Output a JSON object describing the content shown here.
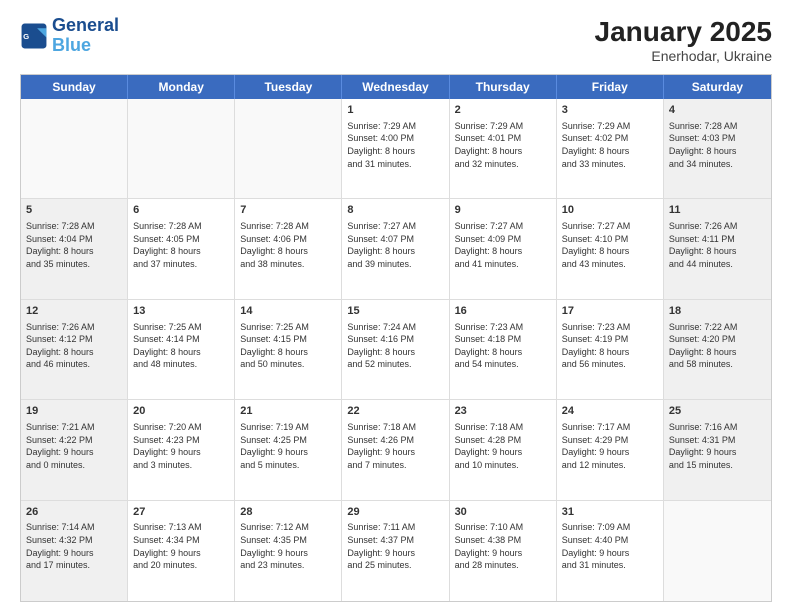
{
  "header": {
    "logo_line1": "General",
    "logo_line2": "Blue",
    "title": "January 2025",
    "subtitle": "Enerhodar, Ukraine"
  },
  "weekdays": [
    "Sunday",
    "Monday",
    "Tuesday",
    "Wednesday",
    "Thursday",
    "Friday",
    "Saturday"
  ],
  "weeks": [
    [
      {
        "day": "",
        "details": "",
        "shaded": false,
        "empty": true
      },
      {
        "day": "",
        "details": "",
        "shaded": false,
        "empty": true
      },
      {
        "day": "",
        "details": "",
        "shaded": false,
        "empty": true
      },
      {
        "day": "1",
        "details": "Sunrise: 7:29 AM\nSunset: 4:00 PM\nDaylight: 8 hours\nand 31 minutes.",
        "shaded": false,
        "empty": false
      },
      {
        "day": "2",
        "details": "Sunrise: 7:29 AM\nSunset: 4:01 PM\nDaylight: 8 hours\nand 32 minutes.",
        "shaded": false,
        "empty": false
      },
      {
        "day": "3",
        "details": "Sunrise: 7:29 AM\nSunset: 4:02 PM\nDaylight: 8 hours\nand 33 minutes.",
        "shaded": false,
        "empty": false
      },
      {
        "day": "4",
        "details": "Sunrise: 7:28 AM\nSunset: 4:03 PM\nDaylight: 8 hours\nand 34 minutes.",
        "shaded": true,
        "empty": false
      }
    ],
    [
      {
        "day": "5",
        "details": "Sunrise: 7:28 AM\nSunset: 4:04 PM\nDaylight: 8 hours\nand 35 minutes.",
        "shaded": true,
        "empty": false
      },
      {
        "day": "6",
        "details": "Sunrise: 7:28 AM\nSunset: 4:05 PM\nDaylight: 8 hours\nand 37 minutes.",
        "shaded": false,
        "empty": false
      },
      {
        "day": "7",
        "details": "Sunrise: 7:28 AM\nSunset: 4:06 PM\nDaylight: 8 hours\nand 38 minutes.",
        "shaded": false,
        "empty": false
      },
      {
        "day": "8",
        "details": "Sunrise: 7:27 AM\nSunset: 4:07 PM\nDaylight: 8 hours\nand 39 minutes.",
        "shaded": false,
        "empty": false
      },
      {
        "day": "9",
        "details": "Sunrise: 7:27 AM\nSunset: 4:09 PM\nDaylight: 8 hours\nand 41 minutes.",
        "shaded": false,
        "empty": false
      },
      {
        "day": "10",
        "details": "Sunrise: 7:27 AM\nSunset: 4:10 PM\nDaylight: 8 hours\nand 43 minutes.",
        "shaded": false,
        "empty": false
      },
      {
        "day": "11",
        "details": "Sunrise: 7:26 AM\nSunset: 4:11 PM\nDaylight: 8 hours\nand 44 minutes.",
        "shaded": true,
        "empty": false
      }
    ],
    [
      {
        "day": "12",
        "details": "Sunrise: 7:26 AM\nSunset: 4:12 PM\nDaylight: 8 hours\nand 46 minutes.",
        "shaded": true,
        "empty": false
      },
      {
        "day": "13",
        "details": "Sunrise: 7:25 AM\nSunset: 4:14 PM\nDaylight: 8 hours\nand 48 minutes.",
        "shaded": false,
        "empty": false
      },
      {
        "day": "14",
        "details": "Sunrise: 7:25 AM\nSunset: 4:15 PM\nDaylight: 8 hours\nand 50 minutes.",
        "shaded": false,
        "empty": false
      },
      {
        "day": "15",
        "details": "Sunrise: 7:24 AM\nSunset: 4:16 PM\nDaylight: 8 hours\nand 52 minutes.",
        "shaded": false,
        "empty": false
      },
      {
        "day": "16",
        "details": "Sunrise: 7:23 AM\nSunset: 4:18 PM\nDaylight: 8 hours\nand 54 minutes.",
        "shaded": false,
        "empty": false
      },
      {
        "day": "17",
        "details": "Sunrise: 7:23 AM\nSunset: 4:19 PM\nDaylight: 8 hours\nand 56 minutes.",
        "shaded": false,
        "empty": false
      },
      {
        "day": "18",
        "details": "Sunrise: 7:22 AM\nSunset: 4:20 PM\nDaylight: 8 hours\nand 58 minutes.",
        "shaded": true,
        "empty": false
      }
    ],
    [
      {
        "day": "19",
        "details": "Sunrise: 7:21 AM\nSunset: 4:22 PM\nDaylight: 9 hours\nand 0 minutes.",
        "shaded": true,
        "empty": false
      },
      {
        "day": "20",
        "details": "Sunrise: 7:20 AM\nSunset: 4:23 PM\nDaylight: 9 hours\nand 3 minutes.",
        "shaded": false,
        "empty": false
      },
      {
        "day": "21",
        "details": "Sunrise: 7:19 AM\nSunset: 4:25 PM\nDaylight: 9 hours\nand 5 minutes.",
        "shaded": false,
        "empty": false
      },
      {
        "day": "22",
        "details": "Sunrise: 7:18 AM\nSunset: 4:26 PM\nDaylight: 9 hours\nand 7 minutes.",
        "shaded": false,
        "empty": false
      },
      {
        "day": "23",
        "details": "Sunrise: 7:18 AM\nSunset: 4:28 PM\nDaylight: 9 hours\nand 10 minutes.",
        "shaded": false,
        "empty": false
      },
      {
        "day": "24",
        "details": "Sunrise: 7:17 AM\nSunset: 4:29 PM\nDaylight: 9 hours\nand 12 minutes.",
        "shaded": false,
        "empty": false
      },
      {
        "day": "25",
        "details": "Sunrise: 7:16 AM\nSunset: 4:31 PM\nDaylight: 9 hours\nand 15 minutes.",
        "shaded": true,
        "empty": false
      }
    ],
    [
      {
        "day": "26",
        "details": "Sunrise: 7:14 AM\nSunset: 4:32 PM\nDaylight: 9 hours\nand 17 minutes.",
        "shaded": true,
        "empty": false
      },
      {
        "day": "27",
        "details": "Sunrise: 7:13 AM\nSunset: 4:34 PM\nDaylight: 9 hours\nand 20 minutes.",
        "shaded": false,
        "empty": false
      },
      {
        "day": "28",
        "details": "Sunrise: 7:12 AM\nSunset: 4:35 PM\nDaylight: 9 hours\nand 23 minutes.",
        "shaded": false,
        "empty": false
      },
      {
        "day": "29",
        "details": "Sunrise: 7:11 AM\nSunset: 4:37 PM\nDaylight: 9 hours\nand 25 minutes.",
        "shaded": false,
        "empty": false
      },
      {
        "day": "30",
        "details": "Sunrise: 7:10 AM\nSunset: 4:38 PM\nDaylight: 9 hours\nand 28 minutes.",
        "shaded": false,
        "empty": false
      },
      {
        "day": "31",
        "details": "Sunrise: 7:09 AM\nSunset: 4:40 PM\nDaylight: 9 hours\nand 31 minutes.",
        "shaded": false,
        "empty": false
      },
      {
        "day": "",
        "details": "",
        "shaded": true,
        "empty": true
      }
    ]
  ]
}
